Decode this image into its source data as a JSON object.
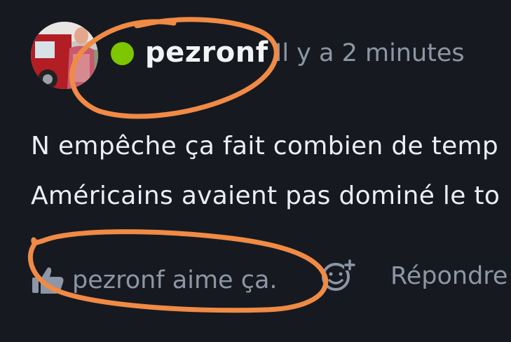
{
  "comment": {
    "author": "pezronf",
    "timestamp": "Il y a 2 minutes",
    "status": "online",
    "message_lines": [
      "N empêche ça fait combien de temp",
      "Américains avaient pas dominé le to"
    ],
    "likes_text": "pezronf aime ça.",
    "reply_label": "Répondre"
  },
  "icons": {
    "avatar": "user-avatar",
    "status": "online-status-dot",
    "like": "thumbs-up-icon",
    "react": "add-reaction-icon"
  },
  "colors": {
    "background": "#161a20",
    "text_primary": "#eceef1",
    "text_secondary": "#8d96a6",
    "status_online": "#7ec600",
    "annotation": "#f08a45"
  }
}
